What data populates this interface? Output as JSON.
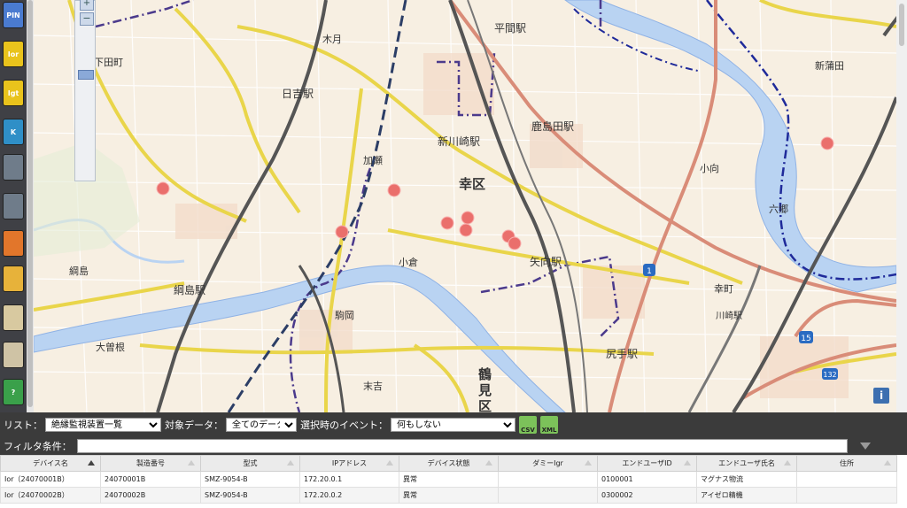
{
  "sidebar": {
    "buttons": [
      {
        "label": "PIN",
        "color": "#4a7bd0"
      },
      {
        "label": "Ior",
        "color": "#e9c31c"
      },
      {
        "label": "Igt",
        "color": "#e9c31c"
      },
      {
        "label": "K",
        "color": "#2f8fc7"
      },
      {
        "label": "",
        "color": "#6f7c8a"
      },
      {
        "label": "",
        "color": "#6f7c8a"
      },
      {
        "label": "",
        "color": "#e2762b"
      },
      {
        "label": "",
        "color": "#e7b23a"
      },
      {
        "label": "",
        "color": "#d8c9a0"
      },
      {
        "label": "",
        "color": "#cfc3a5"
      },
      {
        "label": "?",
        "color": "#3aa04a"
      }
    ]
  },
  "map": {
    "labels": {
      "shimoda": "下田町",
      "kizuki": "木月",
      "hiyoshi": "日吉駅",
      "hiranuma": "平間駅",
      "shinkawasaki": "新川崎駅",
      "kashimada": "鹿島田駅",
      "kase": "加瀬",
      "saiwai": "幸区",
      "komukai": "小向",
      "shinkamata": "新蒲田",
      "rokugo": "六郷",
      "tsunashima": "綱島",
      "tsunashima_st": "綱島駅",
      "ogura": "小倉",
      "yako": "矢向駅",
      "komaoka": "駒岡",
      "saiwaicho": "幸町",
      "kawasaki_st": "川崎駅",
      "osone": "大曽根",
      "shitte": "尻手駅",
      "sueyoshi": "末吉",
      "tsurumi1": "鶴",
      "tsurumi2": "見",
      "tsurumi3": "区"
    },
    "route_shields": [
      "1",
      "15",
      "132"
    ],
    "info_icon": "i"
  },
  "toolbar": {
    "list_label": "リスト：",
    "list_value": "絶縁監視装置一覧",
    "target_label": "対象データ：",
    "target_value": "全てのデータ",
    "event_label": "選択時のイベント：",
    "event_value": "何もしない",
    "csv_label": "CSV",
    "xml_label": "XML"
  },
  "filter": {
    "label": "フィルタ条件：",
    "value": ""
  },
  "table": {
    "headers": [
      "デバイス名",
      "製造番号",
      "型式",
      "IPアドレス",
      "デバイス状態",
      "ダミーIgr",
      "エンドユーザID",
      "エンドユーザ氏名",
      "住所"
    ],
    "rows": [
      [
        "Ior（24070001B）",
        "24070001B",
        "SMZ-9054-B",
        "172.20.0.1",
        "異常",
        "",
        "0100001",
        "マグナス物流",
        ""
      ],
      [
        "Ior（24070002B）",
        "24070002B",
        "SMZ-9054-B",
        "172.20.0.2",
        "異常",
        "",
        "0300002",
        "アイゼロ精機",
        ""
      ]
    ]
  }
}
